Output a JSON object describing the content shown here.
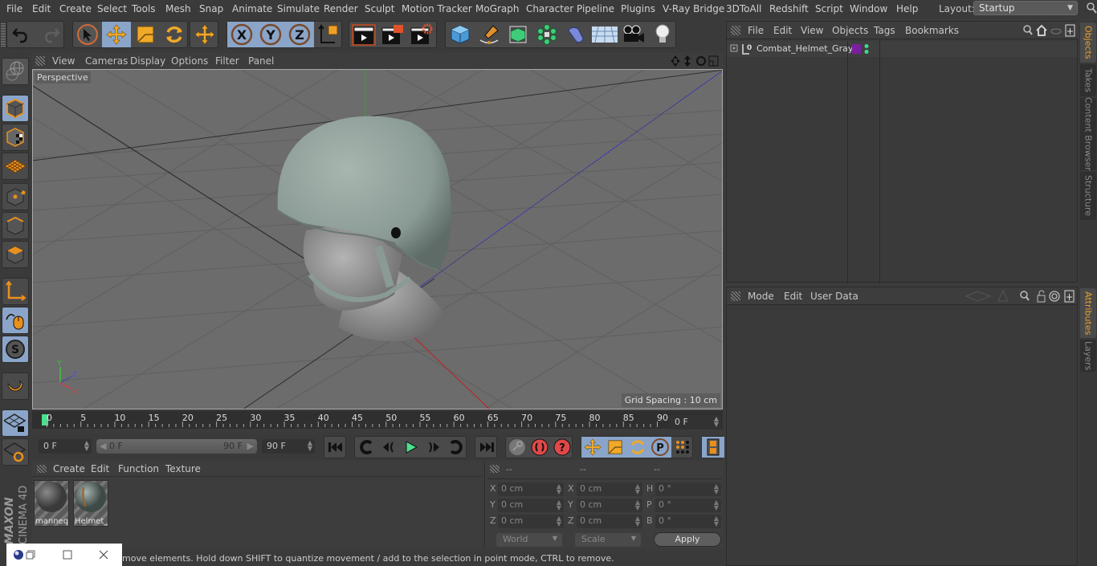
{
  "menubar": {
    "items": [
      "File",
      "Edit",
      "Create",
      "Select",
      "Tools",
      "Mesh",
      "Snap",
      "Animate",
      "Simulate",
      "Render",
      "Sculpt",
      "Motion Tracker",
      "MoGraph",
      "Character",
      "Pipeline",
      "Plugins",
      "V-Ray Bridge",
      "3DToAll",
      "Redshift",
      "Script",
      "Window",
      "Help"
    ],
    "layout_label": "Layout:",
    "layout_value": "Startup"
  },
  "toolbar": {
    "undo": "undo-icon",
    "redo": "redo-icon",
    "axis_x": "X",
    "axis_y": "Y",
    "axis_z": "Z"
  },
  "viewport": {
    "menu": [
      "View",
      "Cameras",
      "Display",
      "Options",
      "Filter",
      "Panel"
    ],
    "camera_label": "Perspective",
    "grid_spacing": "Grid Spacing : 10 cm",
    "axis_labels": {
      "x": "X",
      "y": "Y",
      "z": "Z"
    }
  },
  "timeline": {
    "ticks": [
      "0",
      "5",
      "10",
      "15",
      "20",
      "25",
      "30",
      "35",
      "40",
      "45",
      "50",
      "55",
      "60",
      "65",
      "70",
      "75",
      "80",
      "85",
      "90"
    ],
    "current_frame": "0 F",
    "start_field": "0 F",
    "range_start": "0 F",
    "range_end": "90 F",
    "end_field": "90 F"
  },
  "materials": {
    "menu": [
      "Create",
      "Edit",
      "Function",
      "Texture"
    ],
    "items": [
      {
        "label": "manneq",
        "color": "#6a6a6a"
      },
      {
        "label": "Helmet_",
        "color": "#7e8e88"
      }
    ]
  },
  "coordinates": {
    "headers": [
      "--",
      "--",
      "--"
    ],
    "position": {
      "x": "0 cm",
      "y": "0 cm",
      "z": "0 cm"
    },
    "size": {
      "x": "0 cm",
      "y": "0 cm",
      "z": "0 cm"
    },
    "rotation": {
      "h": "0 °",
      "p": "0 °",
      "b": "0 °"
    },
    "labels": {
      "x": "X",
      "y": "Y",
      "z": "Z",
      "h": "H",
      "p": "P",
      "b": "B"
    },
    "space_select": "World",
    "mode_select": "Scale",
    "apply_label": "Apply"
  },
  "status": {
    "text": "move elements. Hold down SHIFT to quantize movement / add to the selection in point mode, CTRL to remove."
  },
  "objects_panel": {
    "menu": [
      "File",
      "Edit",
      "View",
      "Objects",
      "Tags",
      "Bookmarks"
    ],
    "objects": [
      {
        "name": "Combat_Helmet_Gray",
        "layer_color": "#7a1fa0",
        "dot_color": "#3fdc8a"
      }
    ]
  },
  "attributes_panel": {
    "menu": [
      "Mode",
      "Edit",
      "User Data"
    ]
  },
  "right_tabs": {
    "top": [
      "Objects",
      "Takes",
      "Content Browser",
      "Structure"
    ],
    "bottom": [
      "Attributes",
      "Layers"
    ]
  },
  "branding": {
    "maxon": "MAXON",
    "cinema": "CINEMA 4D"
  },
  "colors": {
    "accent_blue": "#8aa5c9",
    "accent_orange": "#e8a22f",
    "playhead_green": "#4be08e"
  }
}
